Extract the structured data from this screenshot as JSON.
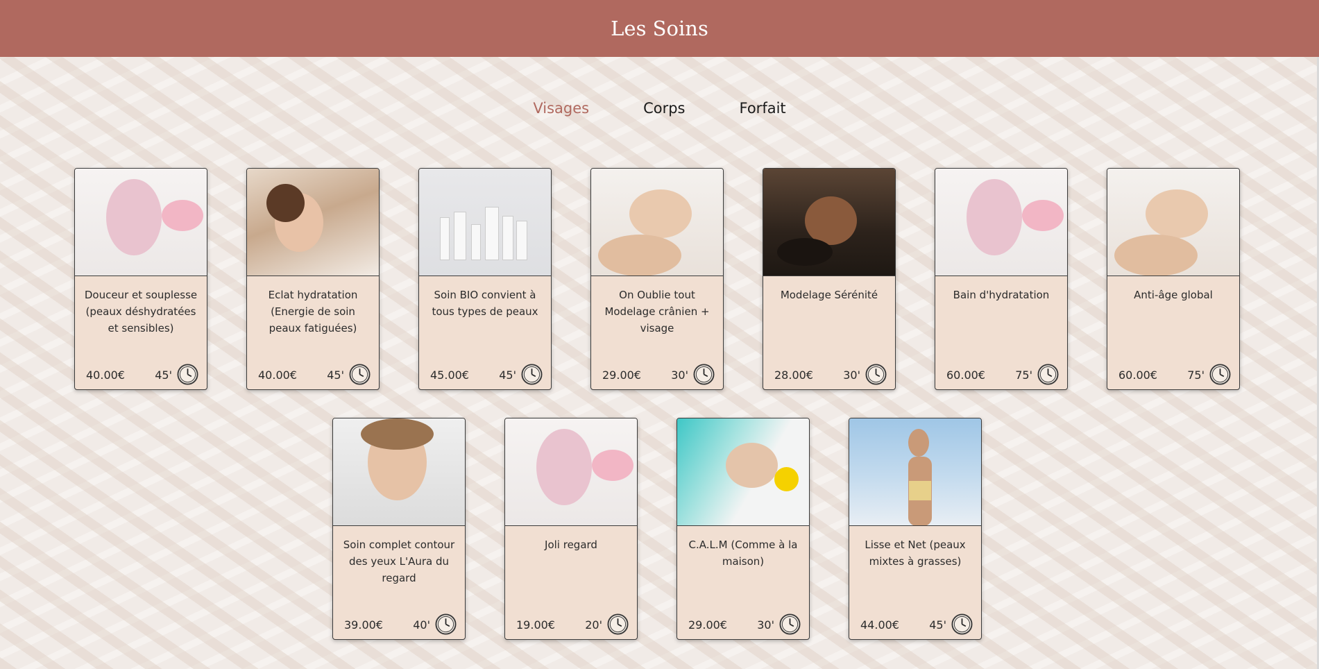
{
  "header": {
    "title": "Les Soins"
  },
  "tabs": [
    {
      "label": "Visages",
      "active": true
    },
    {
      "label": "Corps",
      "active": false
    },
    {
      "label": "Forfait",
      "active": false
    }
  ],
  "colors": {
    "accent": "#b0695f",
    "card_bg": "#f1dfd2",
    "page_bg": "#f1ebe7"
  },
  "cards": [
    {
      "title": "Douceur et souplesse (peaux déshydratées et sensibles)",
      "price": "40.00€",
      "duration": "45'",
      "icon": "clock-icon"
    },
    {
      "title": "Eclat hydratation (Energie de soin peaux fatiguées)",
      "price": "40.00€",
      "duration": "45'",
      "icon": "clock-icon"
    },
    {
      "title": "Soin BIO convient à tous types de peaux",
      "price": "45.00€",
      "duration": "45'",
      "icon": "clock-icon"
    },
    {
      "title": "On Oublie tout Modelage crânien + visage",
      "price": "29.00€",
      "duration": "30'",
      "icon": "clock-icon"
    },
    {
      "title": "Modelage Sérénité",
      "price": "28.00€",
      "duration": "30'",
      "icon": "clock-icon"
    },
    {
      "title": "Bain d'hydratation",
      "price": "60.00€",
      "duration": "75'",
      "icon": "clock-icon"
    },
    {
      "title": "Anti-âge global",
      "price": "60.00€",
      "duration": "75'",
      "icon": "clock-icon"
    },
    {
      "title": "Soin complet contour des yeux L'Aura du regard",
      "price": "39.00€",
      "duration": "40'",
      "icon": "clock-icon"
    },
    {
      "title": "Joli regard",
      "price": "19.00€",
      "duration": "20'",
      "icon": "clock-icon"
    },
    {
      "title": "C.A.L.M (Comme à la maison)",
      "price": "29.00€",
      "duration": "30'",
      "icon": "clock-icon"
    },
    {
      "title": "Lisse et Net (peaux mixtes à grasses)",
      "price": "44.00€",
      "duration": "45'",
      "icon": "clock-icon"
    }
  ]
}
